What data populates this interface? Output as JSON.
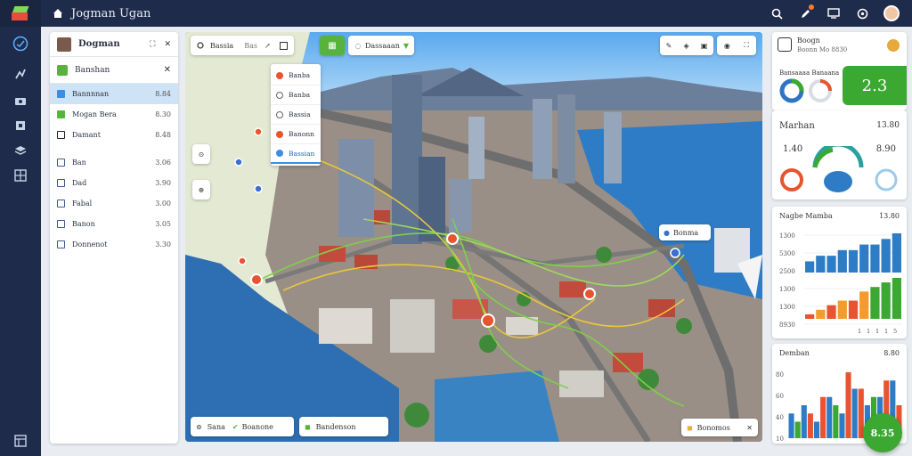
{
  "app": {
    "title": "Jogman Ugan"
  },
  "layer_panel": {
    "title": "Dogman",
    "subheader": "Banshan",
    "layers": [
      {
        "label": "Bannnnan",
        "value": "8.84"
      },
      {
        "label": "Mogan Bera",
        "value": "8.30"
      },
      {
        "label": "Damant",
        "value": "8.48"
      },
      {
        "label": "Ban",
        "value": "3.06"
      },
      {
        "label": "Dad",
        "value": "3.90"
      },
      {
        "label": "Fabal",
        "value": "3.00"
      },
      {
        "label": "Banon",
        "value": "3.05"
      },
      {
        "label": "Donnenot",
        "value": "3.30"
      }
    ]
  },
  "map": {
    "search": {
      "label": "Bassia",
      "secondary": "Bas"
    },
    "filter_label": "Dassaaan",
    "layer_menu": [
      "Banba",
      "Banba",
      "Bassia",
      "Banonn",
      "Bassian"
    ],
    "bottom_bar": {
      "label": "Sana",
      "route_a": "Boanone",
      "route_b": "Bandenson"
    },
    "bottom_right_label": "Bonomos",
    "marker_label": "Bonma"
  },
  "overview_card": {
    "title": "Boogn",
    "subtitle": "Boonn Mo 8830",
    "badge_label": "Bansaaaa Banaana",
    "metric": "2.3"
  },
  "metrics_card": {
    "title": "Marhan",
    "value_a": "13.80",
    "value_b": "1.40",
    "value_c": "8.90"
  },
  "bar_card": {
    "title": "Nagbe Mamba",
    "title_value": "13.80"
  },
  "bottom_card": {
    "title": "Demban",
    "title_value": "8.80"
  },
  "fab_label": "8.35",
  "chart_data": [
    {
      "type": "bar",
      "series": [
        {
          "values": [
            2,
            3,
            3,
            4,
            4,
            5,
            5,
            6,
            7
          ]
        },
        {
          "values": [
            0.5,
            1,
            1.5,
            2,
            2,
            3,
            3.5,
            4,
            4.5
          ]
        }
      ],
      "yticks": [
        "1300",
        "5300",
        "2500",
        "1300",
        "1300",
        "8930"
      ],
      "xticks": [
        "1",
        "1",
        "1",
        "1",
        "5"
      ]
    },
    {
      "type": "bar",
      "series": [
        {
          "values": [
            3,
            4,
            2,
            5,
            3,
            6,
            4,
            5,
            7
          ]
        },
        {
          "values": [
            2,
            3,
            5,
            4,
            8,
            6,
            5,
            7,
            4
          ]
        }
      ],
      "yticks": [
        "80",
        "60",
        "40",
        "10"
      ]
    }
  ]
}
